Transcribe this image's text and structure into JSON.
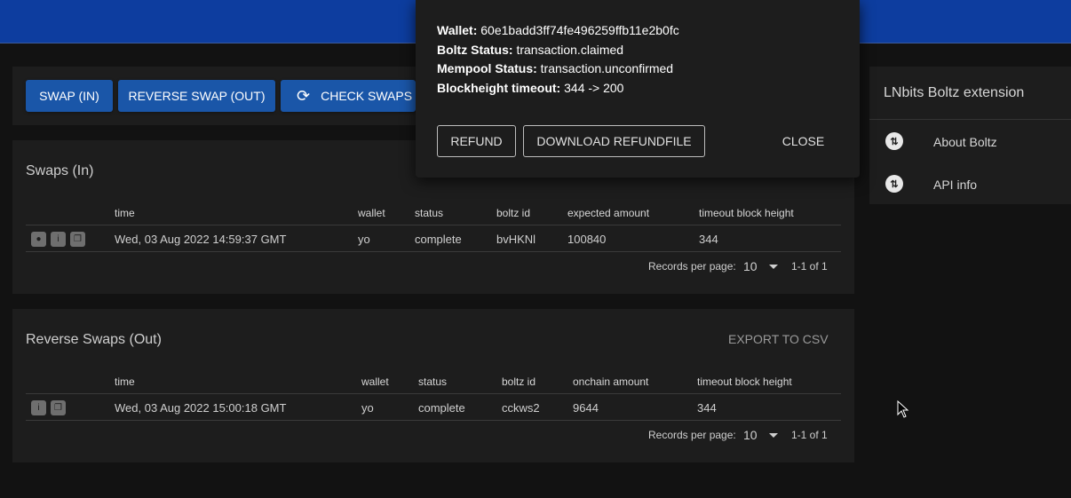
{
  "toolbar": {
    "swap_in_label": "SWAP (IN)",
    "reverse_swap_label": "REVERSE SWAP (OUT)",
    "check_swaps_label": "CHECK SWAPS"
  },
  "swaps_in": {
    "title": "Swaps (In)",
    "columns": [
      "time",
      "wallet",
      "status",
      "boltz id",
      "expected amount",
      "timeout block height"
    ],
    "rows": [
      {
        "time": "Wed, 03 Aug 2022 14:59:37 GMT",
        "wallet": "yo",
        "status": "complete",
        "boltz_id": "bvHKNl",
        "amount": "100840",
        "timeout": "344"
      }
    ],
    "pagination": {
      "label": "Records per page:",
      "per_page": "10",
      "range": "1-1 of 1"
    }
  },
  "reverse_swaps": {
    "title": "Reverse Swaps (Out)",
    "export_label": "EXPORT TO CSV",
    "columns": [
      "time",
      "wallet",
      "status",
      "boltz id",
      "onchain amount",
      "timeout block height"
    ],
    "rows": [
      {
        "time": "Wed, 03 Aug 2022 15:00:18 GMT",
        "wallet": "yo",
        "status": "complete",
        "boltz_id": "cckws2",
        "amount": "9644",
        "timeout": "344"
      }
    ],
    "pagination": {
      "label": "Records per page:",
      "per_page": "10",
      "range": "1-1 of 1"
    }
  },
  "sidebar": {
    "title": "LNbits Boltz extension",
    "items": [
      {
        "label": "About Boltz",
        "icon": "swap-icon"
      },
      {
        "label": "API info",
        "icon": "swap-icon"
      }
    ]
  },
  "dialog": {
    "wallet_label": "Wallet:",
    "wallet_value": "60e1badd3ff74fe496259ffb11e2b0fc",
    "boltz_status_label": "Boltz Status:",
    "boltz_status_value": "transaction.claimed",
    "mempool_status_label": "Mempool Status:",
    "mempool_status_value": "transaction.unconfirmed",
    "blockheight_label": "Blockheight timeout:",
    "blockheight_value": "344 -> 200",
    "refund_label": "REFUND",
    "download_label": "DOWNLOAD REFUNDFILE",
    "close_label": "CLOSE"
  },
  "colors": {
    "header": "#0d3d9f",
    "primary_button": "#1a56a8",
    "background": "#121212",
    "card": "#1d1d1d"
  }
}
